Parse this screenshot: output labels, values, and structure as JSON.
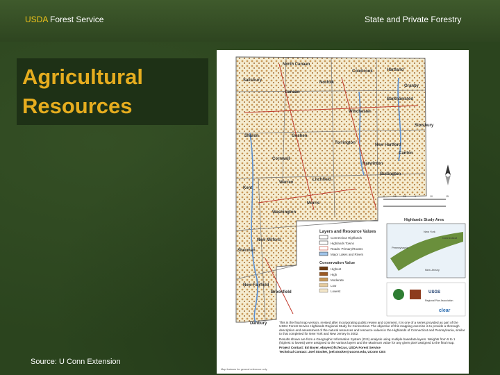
{
  "header": {
    "agency_prefix": "USDA",
    "agency_name": "Forest Service",
    "program": "State and Private Forestry"
  },
  "slide": {
    "title": "Agricultural\nResources",
    "source": "Source: U Conn Extension"
  },
  "map": {
    "towns": [
      "North Canaan",
      "Colebrook",
      "Hartland",
      "Salisbury",
      "Norfolk",
      "Granby",
      "Canaan",
      "Winchester",
      "Barkhamsted",
      "Sharon",
      "Goshen",
      "Torrington",
      "New Hartford",
      "Canton",
      "Simsbury",
      "Cornwall",
      "Harwinton",
      "Burlington",
      "Kent",
      "Warren",
      "Litchfield",
      "Morris",
      "Washington",
      "New Milford",
      "Sherman",
      "New Fairfield",
      "Brookfield",
      "Danbury"
    ],
    "legend": {
      "heading": "Layers and Resource Values",
      "layers": [
        "Connecticut Highlands",
        "Highlands Towns",
        "Roads: Primary/Routes",
        "Major Lakes and Rivers"
      ],
      "conservation_heading": "Conservation Value",
      "conservation_values": [
        "Highest",
        "High",
        "Moderate",
        "Low",
        "Lowest"
      ],
      "conservation_colors": [
        "#6b3a12",
        "#9a5a25",
        "#c79a5c",
        "#e3c99b",
        "#f3e6c8"
      ]
    },
    "inset": {
      "title": "Highlands Study Area",
      "labels": [
        "New York",
        "Connecticut",
        "Pennsylvania",
        "New Jersey"
      ]
    },
    "scale_ticks": [
      "0",
      "1/5",
      "2/5",
      "5",
      "10",
      "15"
    ],
    "description": "This is the final map version, revised after incorporating public review and comment. It is one of a series provided as part of the USDA Forest Service Highlands Regional Study for Connecticut. The objective of this mapping exercise is to provide a thorough description and assessment of the natural resources and resource values in the Highlands of Connecticut and Pennsylvania, similar to that completed for New York and New Jersey in 2002.",
    "description2": "Results shown are from a Geographic Information System (GIS) analysis using multiple basedata layers. Weights from 5 to 1 (highest to lowest) were assigned to the various layers and the Maximum value for any given pixel assigned to the final map.",
    "contacts": [
      "Project Contact: Ed Boyer, eboyer@fs.fed.us, USDA Forest Service",
      "Technical Contact: Joel Stocker, joel.stocker@uconn.edu, UConn CES"
    ],
    "footnote": "Map features for general reference only",
    "logos": [
      "USGS",
      "Regional Plan Association",
      "clear"
    ]
  }
}
